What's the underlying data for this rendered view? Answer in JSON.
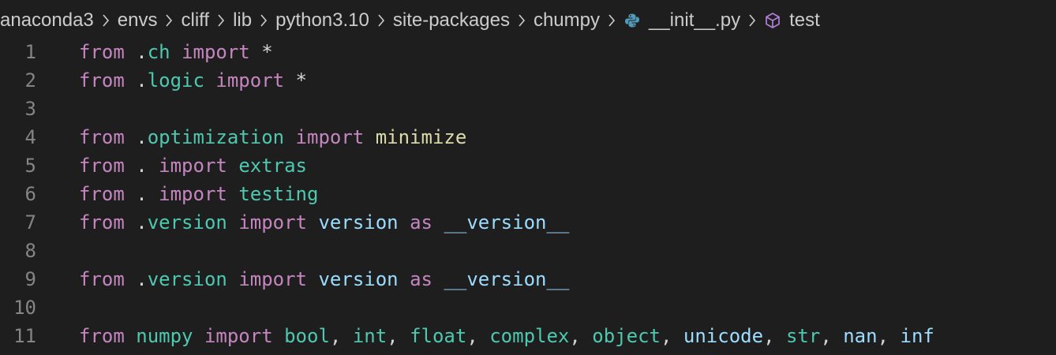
{
  "breadcrumb": {
    "items": [
      "anaconda3",
      "envs",
      "cliff",
      "lib",
      "python3.10",
      "site-packages",
      "chumpy"
    ],
    "file": {
      "label": "__init__.py",
      "icon": "python-icon"
    },
    "symbol": {
      "label": "test",
      "icon": "cube-icon"
    },
    "separator_icon": "chevron-right-icon"
  },
  "editor": {
    "lines": [
      {
        "number": "1",
        "tokens": [
          {
            "text": "from",
            "kind": "kw"
          },
          {
            "text": " .",
            "kind": "pl"
          },
          {
            "text": "ch",
            "kind": "mod"
          },
          {
            "text": " ",
            "kind": "pl"
          },
          {
            "text": "import",
            "kind": "kw"
          },
          {
            "text": " *",
            "kind": "pl"
          }
        ]
      },
      {
        "number": "2",
        "tokens": [
          {
            "text": "from",
            "kind": "kw"
          },
          {
            "text": " .",
            "kind": "pl"
          },
          {
            "text": "logic",
            "kind": "mod"
          },
          {
            "text": " ",
            "kind": "pl"
          },
          {
            "text": "import",
            "kind": "kw"
          },
          {
            "text": " *",
            "kind": "pl"
          }
        ]
      },
      {
        "number": "3",
        "tokens": []
      },
      {
        "number": "4",
        "tokens": [
          {
            "text": "from",
            "kind": "kw"
          },
          {
            "text": " .",
            "kind": "pl"
          },
          {
            "text": "optimization",
            "kind": "mod"
          },
          {
            "text": " ",
            "kind": "pl"
          },
          {
            "text": "import",
            "kind": "kw"
          },
          {
            "text": " ",
            "kind": "pl"
          },
          {
            "text": "minimize",
            "kind": "fn"
          }
        ]
      },
      {
        "number": "5",
        "tokens": [
          {
            "text": "from",
            "kind": "kw"
          },
          {
            "text": " . ",
            "kind": "pl"
          },
          {
            "text": "import",
            "kind": "kw"
          },
          {
            "text": " ",
            "kind": "pl"
          },
          {
            "text": "extras",
            "kind": "mod"
          }
        ]
      },
      {
        "number": "6",
        "tokens": [
          {
            "text": "from",
            "kind": "kw"
          },
          {
            "text": " . ",
            "kind": "pl"
          },
          {
            "text": "import",
            "kind": "kw"
          },
          {
            "text": " ",
            "kind": "pl"
          },
          {
            "text": "testing",
            "kind": "mod"
          }
        ]
      },
      {
        "number": "7",
        "tokens": [
          {
            "text": "from",
            "kind": "kw"
          },
          {
            "text": " .",
            "kind": "pl"
          },
          {
            "text": "version",
            "kind": "mod"
          },
          {
            "text": " ",
            "kind": "pl"
          },
          {
            "text": "import",
            "kind": "kw"
          },
          {
            "text": " ",
            "kind": "pl"
          },
          {
            "text": "version",
            "kind": "var"
          },
          {
            "text": " ",
            "kind": "pl"
          },
          {
            "text": "as",
            "kind": "kw"
          },
          {
            "text": " ",
            "kind": "pl"
          },
          {
            "text": "__version__",
            "kind": "var"
          }
        ]
      },
      {
        "number": "8",
        "tokens": []
      },
      {
        "number": "9",
        "tokens": [
          {
            "text": "from",
            "kind": "kw"
          },
          {
            "text": " .",
            "kind": "pl"
          },
          {
            "text": "version",
            "kind": "mod"
          },
          {
            "text": " ",
            "kind": "pl"
          },
          {
            "text": "import",
            "kind": "kw"
          },
          {
            "text": " ",
            "kind": "pl"
          },
          {
            "text": "version",
            "kind": "var"
          },
          {
            "text": " ",
            "kind": "pl"
          },
          {
            "text": "as",
            "kind": "kw"
          },
          {
            "text": " ",
            "kind": "pl"
          },
          {
            "text": "__version__",
            "kind": "var"
          }
        ]
      },
      {
        "number": "10",
        "tokens": []
      },
      {
        "number": "11",
        "tokens": [
          {
            "text": "from",
            "kind": "kw"
          },
          {
            "text": " ",
            "kind": "pl"
          },
          {
            "text": "numpy",
            "kind": "mod"
          },
          {
            "text": " ",
            "kind": "pl"
          },
          {
            "text": "import",
            "kind": "kw"
          },
          {
            "text": " ",
            "kind": "pl"
          },
          {
            "text": "bool",
            "kind": "mod"
          },
          {
            "text": ", ",
            "kind": "pl"
          },
          {
            "text": "int",
            "kind": "mod"
          },
          {
            "text": ", ",
            "kind": "pl"
          },
          {
            "text": "float",
            "kind": "mod"
          },
          {
            "text": ", ",
            "kind": "pl"
          },
          {
            "text": "complex",
            "kind": "mod"
          },
          {
            "text": ", ",
            "kind": "pl"
          },
          {
            "text": "object",
            "kind": "mod"
          },
          {
            "text": ", ",
            "kind": "pl"
          },
          {
            "text": "unicode",
            "kind": "var"
          },
          {
            "text": ", ",
            "kind": "pl"
          },
          {
            "text": "str",
            "kind": "mod"
          },
          {
            "text": ", ",
            "kind": "pl"
          },
          {
            "text": "nan",
            "kind": "var"
          },
          {
            "text": ", ",
            "kind": "pl"
          },
          {
            "text": "inf",
            "kind": "var"
          }
        ]
      }
    ]
  },
  "colors": {
    "background": "#1e1e1e",
    "keyword": "#c586c0",
    "module": "#4ec9b0",
    "function": "#dcdcaa",
    "variable": "#9cdcfe",
    "plain": "#d4d4d4",
    "line_number": "#858585",
    "breadcrumb_text": "#cccccc",
    "python_icon": "#519aba",
    "symbol_icon": "#b180d7"
  }
}
